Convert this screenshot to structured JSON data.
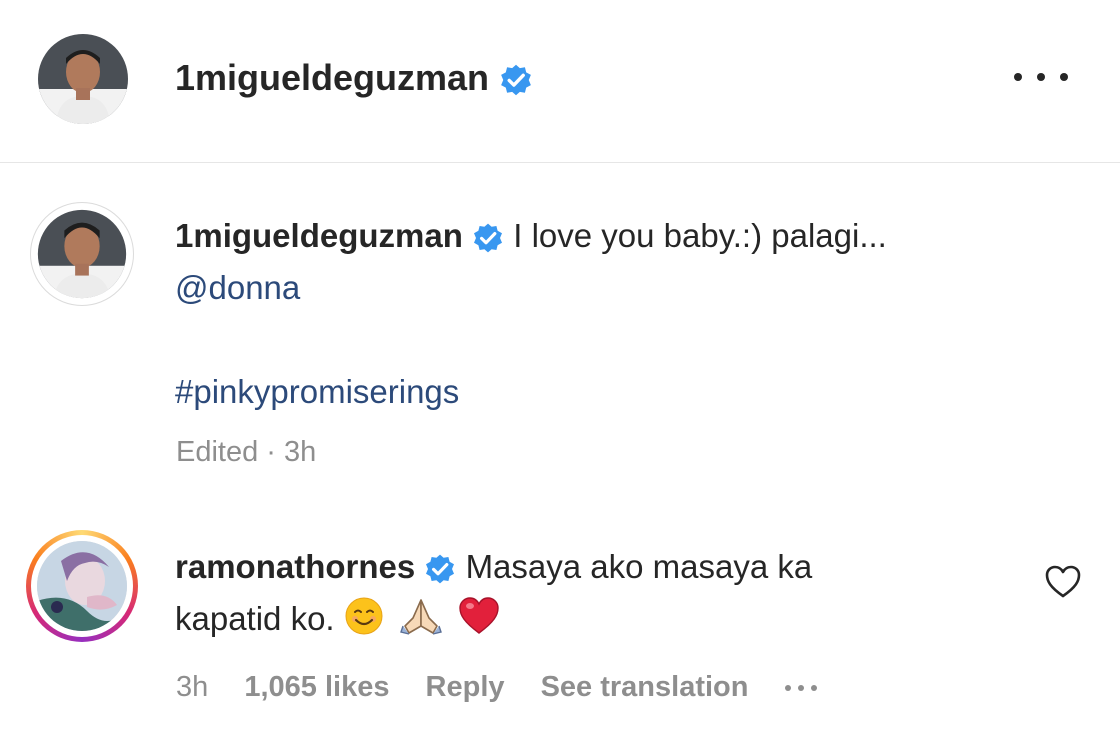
{
  "post": {
    "author": "1migueldeguzman",
    "more_icon": "more-horizontal-icon"
  },
  "caption": {
    "author": "1migueldeguzman",
    "text": "I love you baby.:) palagi...",
    "mention": "@donna",
    "hashtag": "#pinkypromiserings",
    "edited": "Edited",
    "separator": "·",
    "time": "3h"
  },
  "comment": {
    "author": "ramonathornes",
    "text_line1": "Masaya ako masaya ka",
    "text_line2": "kapatid ko.",
    "time": "3h",
    "likes": "1,065 likes",
    "reply": "Reply",
    "see_translation": "See translation",
    "emojis": [
      "smiling-face-emoji",
      "folded-hands-emoji",
      "red-heart-emoji"
    ]
  },
  "colors": {
    "verified_blue": "#3897f0",
    "link_blue": "#2c4a7a",
    "muted_gray": "#8e8e8e",
    "text": "#262626"
  }
}
